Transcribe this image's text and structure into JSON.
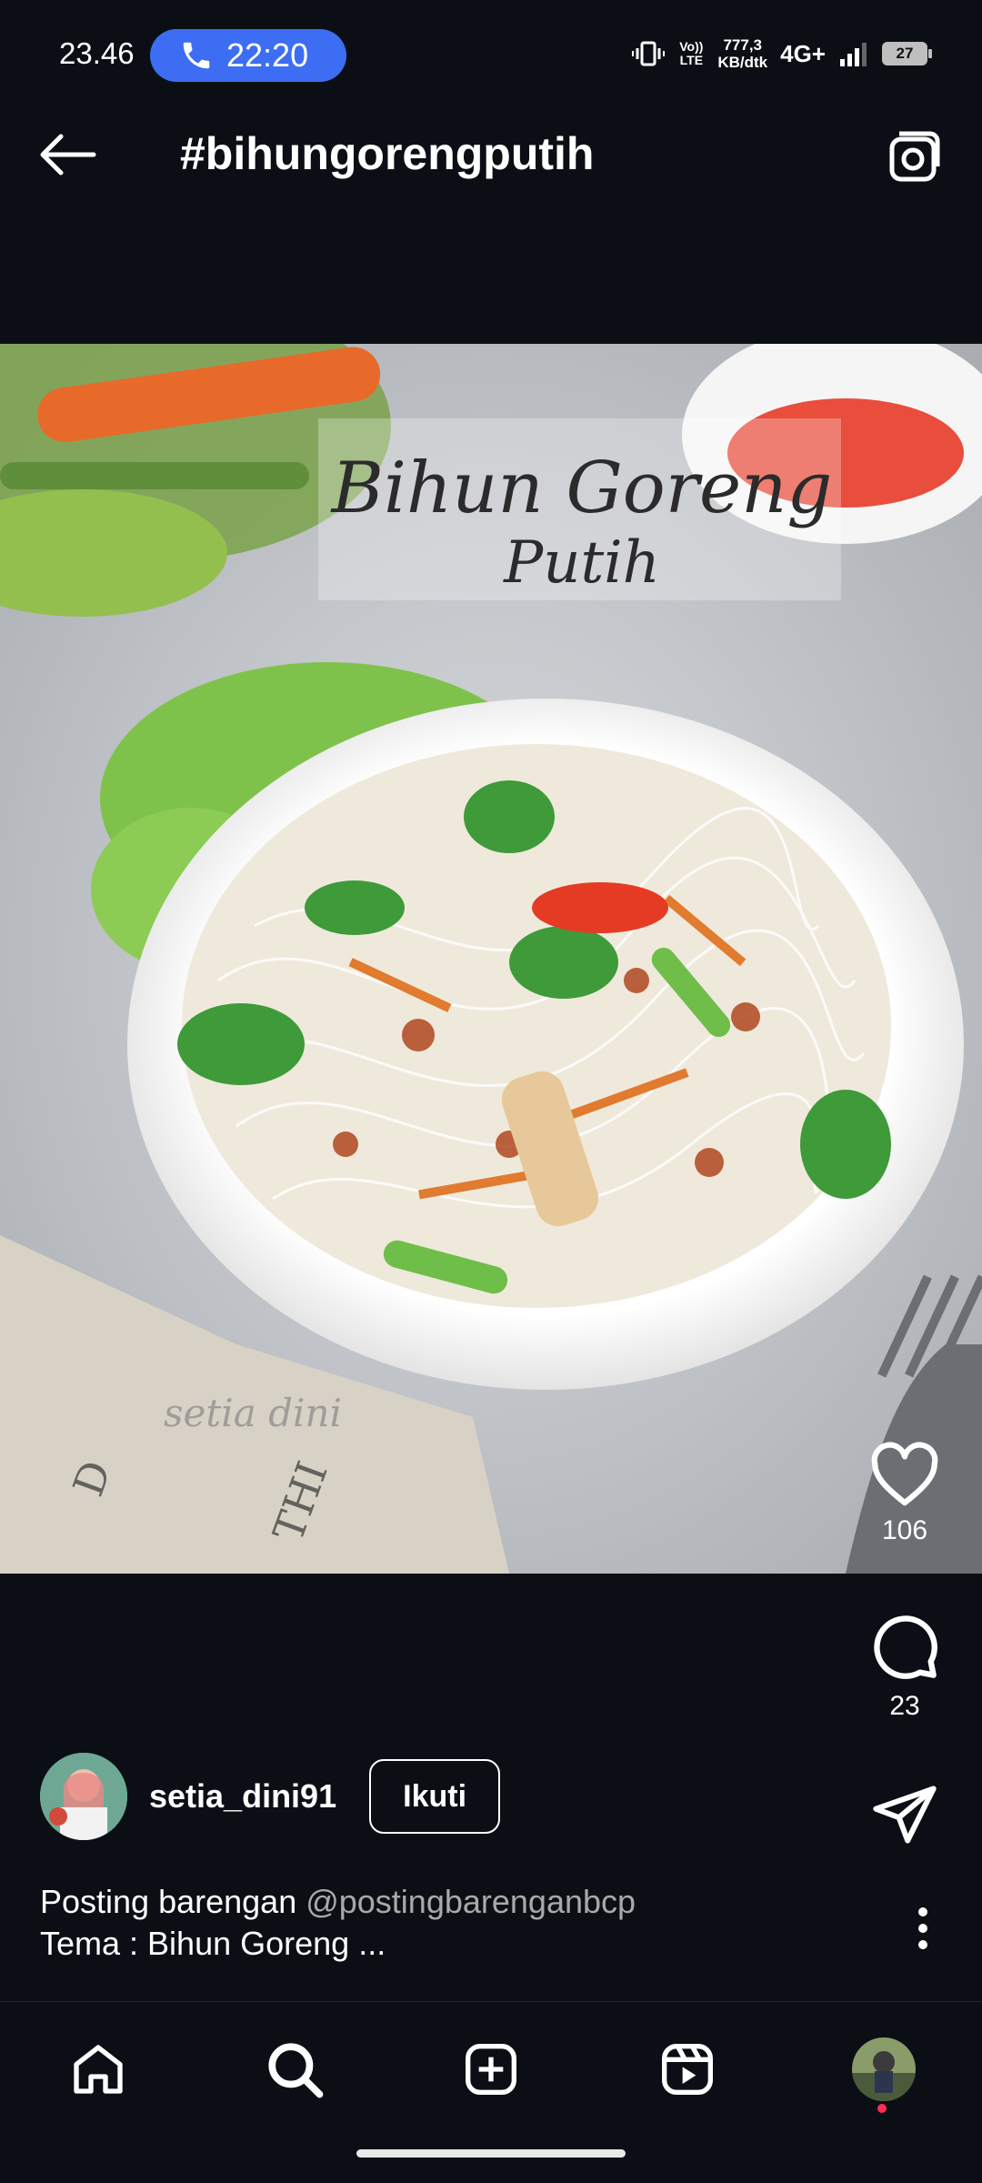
{
  "status": {
    "time": "23.46",
    "call_time": "22:20",
    "network_speed_value": "777,3",
    "network_speed_unit": "KB/dtk",
    "volte": "Vo)) LTE",
    "network_type": "4G+",
    "battery": "27",
    "icons": [
      "phone-icon",
      "vibrate-icon",
      "signal-icon",
      "battery-icon"
    ]
  },
  "header": {
    "title": "#bihungorengputih",
    "back_icon": "back-arrow-icon",
    "camera_icon": "camera-icon"
  },
  "post": {
    "overlay_title_line1": "Bihun Goreng",
    "overlay_title_line2": "Putih",
    "watermark": "setia dini",
    "likes": "106",
    "comments": "23",
    "username": "setia_dini91",
    "follow_label": "Ikuti",
    "caption_prefix": "Posting barengan ",
    "caption_mention": "@postingbarenganbcp",
    "caption_line2": "Tema : Bihun Goreng ..."
  },
  "nav": {
    "items": [
      "home-icon",
      "search-icon",
      "create-icon",
      "reels-icon",
      "profile-avatar"
    ],
    "notification_color": "#ff2d55"
  },
  "colors": {
    "background": "#0b0f15",
    "call_pill": "#3d6df2",
    "mention": "#a9a9a9"
  }
}
